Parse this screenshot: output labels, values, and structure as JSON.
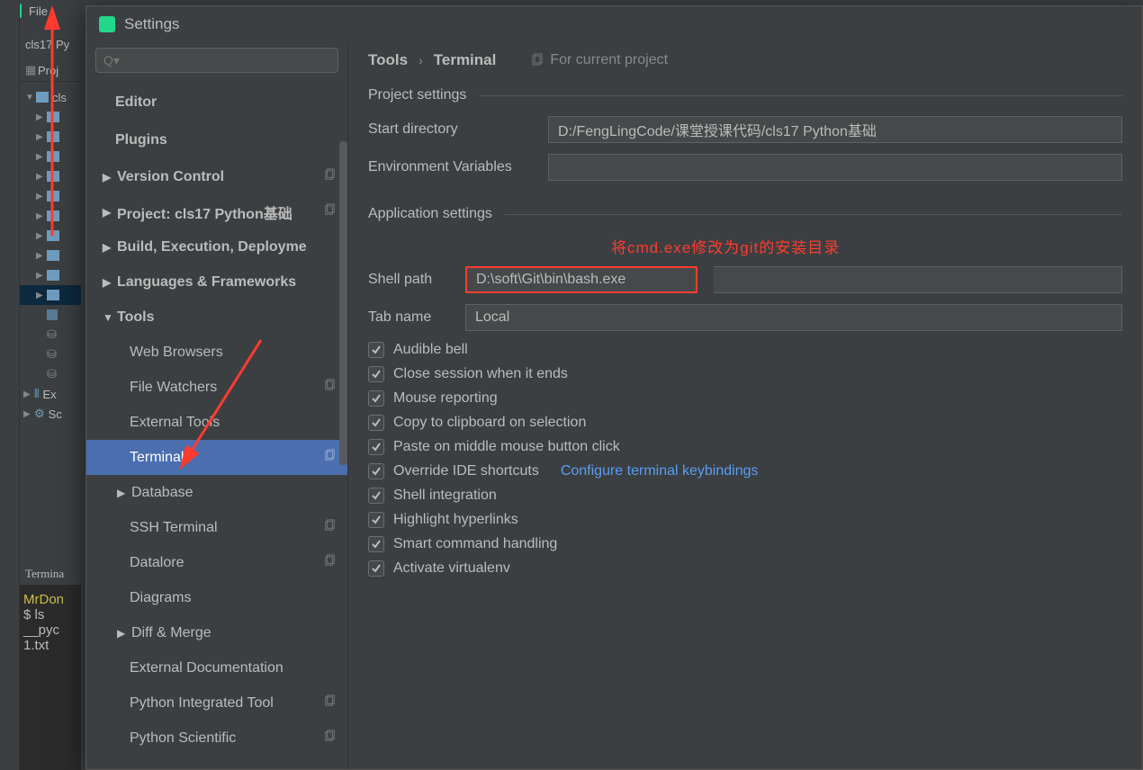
{
  "menubar": {
    "file": "File"
  },
  "crumb": {
    "project_name": "cls17 Py"
  },
  "project_panel": {
    "header": "Proj",
    "root": "cls"
  },
  "terminal": {
    "tab": "Termina",
    "line1": "MrDon",
    "line2_prompt": "$ ",
    "line2_cmd": "ls",
    "line3": "__pyc",
    "line4": "1.txt"
  },
  "dialog": {
    "title": "Settings",
    "search_placeholder": "Q▾",
    "breadcrumb": {
      "root": "Tools",
      "sep": "›",
      "leaf": "Terminal",
      "for_project": "For current project"
    },
    "sidebar": {
      "editor": "Editor",
      "plugins": "Plugins",
      "version_control": "Version Control",
      "project": "Project: cls17 Python基础",
      "build": "Build, Execution, Deployme",
      "languages": "Languages & Frameworks",
      "tools": "Tools",
      "tools_children": {
        "web_browsers": "Web Browsers",
        "file_watchers": "File Watchers",
        "external_tools": "External Tools",
        "terminal": "Terminal",
        "database": "Database",
        "ssh_terminal": "SSH Terminal",
        "datalore": "Datalore",
        "diagrams": "Diagrams",
        "diff_merge": "Diff & Merge",
        "external_docs": "External Documentation",
        "python_integrated": "Python Integrated Tool",
        "python_scientific": "Python Scientific"
      }
    },
    "project_settings": {
      "legend": "Project settings",
      "start_directory_label": "Start directory",
      "start_directory_value": "D:/FengLingCode/课堂授课代码/cls17 Python基础",
      "env_vars_label": "Environment Variables",
      "env_vars_value": ""
    },
    "application_settings": {
      "legend": "Application settings",
      "annotation": "将cmd.exe修改为git的安装目录",
      "shell_path_label": "Shell path",
      "shell_path_value": "D:\\soft\\Git\\bin\\bash.exe",
      "tab_name_label": "Tab name",
      "tab_name_value": "Local",
      "checks": {
        "audible_bell": "Audible bell",
        "close_session": "Close session when it ends",
        "mouse_reporting": "Mouse reporting",
        "copy_clipboard": "Copy to clipboard on selection",
        "paste_middle": "Paste on middle mouse button click",
        "override_ide": "Override IDE shortcuts",
        "configure_link": "Configure terminal keybindings",
        "shell_integration": "Shell integration",
        "highlight_hyperlinks": "Highlight hyperlinks",
        "smart_command": "Smart command handling",
        "activate_venv": "Activate virtualenv"
      }
    }
  }
}
